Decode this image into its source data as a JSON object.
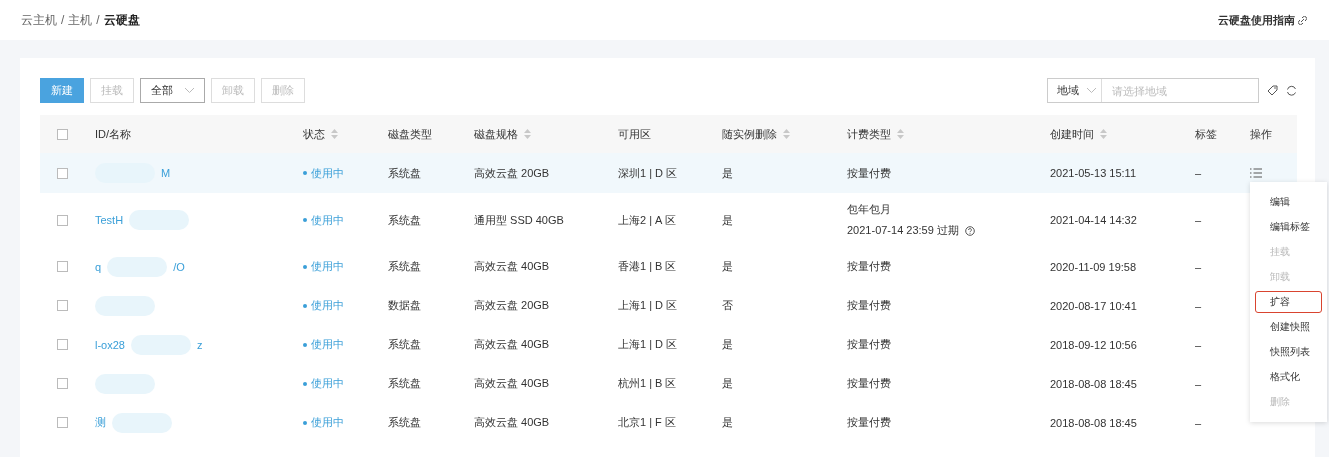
{
  "breadcrumb": [
    "云主机",
    "主机",
    "云硬盘"
  ],
  "breadcrumb_separator": "/",
  "guide_link": "云硬盘使用指南",
  "toolbar": {
    "buttons": [
      {
        "label": "新建",
        "kind": "primary",
        "disabled": false
      },
      {
        "label": "挂载",
        "kind": "plain",
        "disabled": true
      },
      {
        "label": "全部",
        "kind": "select",
        "disabled": false
      },
      {
        "label": "卸载",
        "kind": "plain",
        "disabled": true
      },
      {
        "label": "删除",
        "kind": "plain",
        "disabled": true
      }
    ],
    "region_select": "地域",
    "region_placeholder": "请选择地域"
  },
  "table": {
    "all_checked": false,
    "columns": [
      {
        "label": "ID/名称",
        "sortable": false
      },
      {
        "label": "状态",
        "sortable": true
      },
      {
        "label": "磁盘类型",
        "sortable": false
      },
      {
        "label": "磁盘规格",
        "sortable": true
      },
      {
        "label": "可用区",
        "sortable": false
      },
      {
        "label": "随实例删除",
        "sortable": true
      },
      {
        "label": "计费类型",
        "sortable": true
      },
      {
        "label": "创建时间",
        "sortable": true
      },
      {
        "label": "标签",
        "sortable": false
      },
      {
        "label": "操作",
        "sortable": false
      }
    ],
    "rows": [
      {
        "checked": false,
        "hovered": true,
        "name_end": "M",
        "status": "使用中",
        "type": "系统盘",
        "spec": "高效云盘 20GB",
        "zone": "深圳1 | D 区",
        "delete_with_instance": "是",
        "billing": "按量付费",
        "created": "2021-05-13 15:11",
        "tag": "–",
        "menu_icon": true
      },
      {
        "checked": false,
        "hovered": false,
        "name_start": "TestH",
        "status": "使用中",
        "type": "系统盘",
        "spec": "通用型 SSD 40GB",
        "zone": "上海2 | A 区",
        "delete_with_instance": "是",
        "billing": "包年包月",
        "billing_note": "2021-07-14 23:59 过期",
        "created": "2021-04-14 14:32",
        "tag": "–"
      },
      {
        "checked": false,
        "hovered": false,
        "name_start": "q",
        "name_end": "/O",
        "status": "使用中",
        "type": "系统盘",
        "spec": "高效云盘 40GB",
        "zone": "香港1 | B 区",
        "delete_with_instance": "是",
        "billing": "按量付费",
        "created": "2020-11-09 19:58",
        "tag": "–"
      },
      {
        "checked": false,
        "hovered": false,
        "status": "使用中",
        "type": "数据盘",
        "spec": "高效云盘 20GB",
        "zone": "上海1 | D 区",
        "delete_with_instance": "否",
        "billing": "按量付费",
        "created": "2020-08-17 10:41",
        "tag": "–"
      },
      {
        "checked": false,
        "hovered": false,
        "name_start": "l-ox28",
        "name_end": "z",
        "status": "使用中",
        "type": "系统盘",
        "spec": "高效云盘 40GB",
        "zone": "上海1 | D 区",
        "delete_with_instance": "是",
        "billing": "按量付费",
        "created": "2018-09-12 10:56",
        "tag": "–"
      },
      {
        "checked": false,
        "hovered": false,
        "status": "使用中",
        "type": "系统盘",
        "spec": "高效云盘 40GB",
        "zone": "杭州1 | B 区",
        "delete_with_instance": "是",
        "billing": "按量付费",
        "created": "2018-08-08 18:45",
        "tag": "–"
      },
      {
        "checked": false,
        "hovered": false,
        "name_start": "测",
        "status": "使用中",
        "type": "系统盘",
        "spec": "高效云盘 40GB",
        "zone": "北京1 | F 区",
        "delete_with_instance": "是",
        "billing": "按量付费",
        "created": "2018-08-08 18:45",
        "tag": "–"
      }
    ]
  },
  "action_menu": [
    {
      "label": "编辑",
      "disabled": false,
      "outlined": false
    },
    {
      "label": "编辑标签",
      "disabled": false,
      "outlined": false
    },
    {
      "label": "挂载",
      "disabled": true,
      "outlined": false
    },
    {
      "label": "卸载",
      "disabled": true,
      "outlined": false
    },
    {
      "label": "扩容",
      "disabled": false,
      "outlined": true
    },
    {
      "label": "创建快照",
      "disabled": false,
      "outlined": false
    },
    {
      "label": "快照列表",
      "disabled": false,
      "outlined": false
    },
    {
      "label": "格式化",
      "disabled": false,
      "outlined": false
    },
    {
      "label": "删除",
      "disabled": true,
      "outlined": false
    }
  ]
}
